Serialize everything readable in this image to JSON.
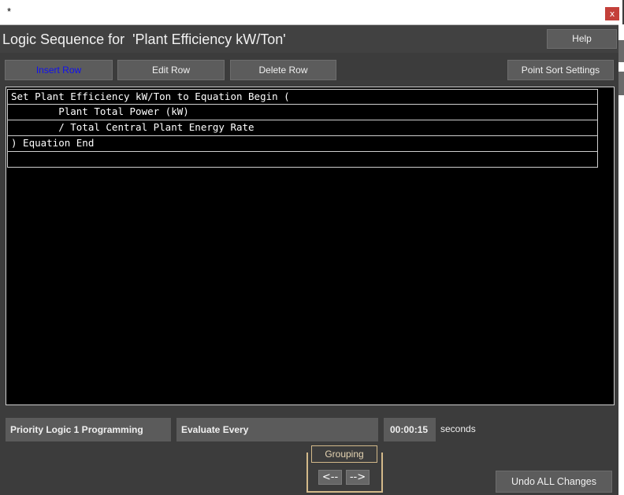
{
  "window": {
    "title": "*",
    "close_glyph": "x"
  },
  "header": {
    "title": "Logic Sequence for  'Plant Efficiency kW/Ton'",
    "help_label": "Help"
  },
  "toolbar": {
    "insert_row_label": "Insert Row",
    "edit_row_label": "Edit Row",
    "delete_row_label": "Delete Row",
    "point_sort_label": "Point Sort Settings"
  },
  "sequence_rows": [
    "Set Plant Efficiency kW/Ton to Equation Begin (",
    "        Plant Total Power (kW)",
    "        / Total Central Plant Energy Rate",
    ") Equation End",
    ""
  ],
  "status": {
    "priority_label": "Priority Logic 1 Programming",
    "evaluate_label": "Evaluate Every",
    "interval_value": "00:00:15",
    "interval_unit": "seconds"
  },
  "grouping": {
    "label": "Grouping",
    "prev_label": "<--",
    "next_label": "-->"
  },
  "undo_label": "Undo ALL Changes",
  "colors": {
    "insert_row_text": "#0000ee",
    "close_button": "#c4403a",
    "grouping_border": "#d3b98a"
  }
}
